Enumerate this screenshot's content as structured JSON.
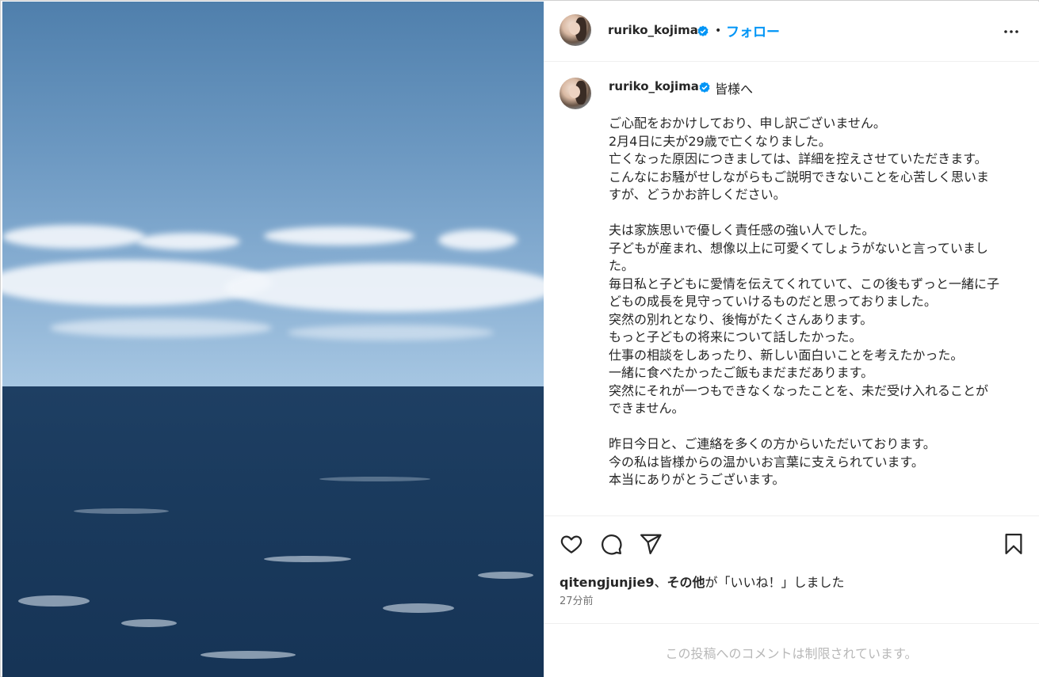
{
  "header": {
    "username": "ruriko_kojima",
    "separator": "•",
    "follow_label": "フォロー"
  },
  "caption": {
    "username": "ruriko_kojima",
    "lead": "皆様へ",
    "text": "ご心配をおかけしており、申し訳ございません。\n2月4日に夫が29歳で亡くなりました。\n亡くなった原因につきましては、詳細を控えさせていただきます。\nこんなにお騒がせしながらもご説明できないことを心苦しく思いますが、どうかお許しください。\n\n夫は家族思いで優しく責任感の強い人でした。\n子どもが産まれ、想像以上に可愛くてしょうがないと言っていました。\n毎日私と子どもに愛情を伝えてくれていて、この後もずっと一緒に子どもの成長を見守っていけるものだと思っておりました。\n突然の別れとなり、後悔がたくさんあります。\nもっと子どもの将来について話したかった。\n仕事の相談をしあったり、新しい面白いことを考えたかった。\n一緒に食べたかったご飯もまだまだあります。\n突然にそれが一つもできなくなったことを、未だ受け入れることができません。\n\n昨日今日と、ご連絡を多くの方からいただいております。\n今の私は皆様からの温かいお言葉に支えられています。\n本当にありがとうございます。"
  },
  "likes": {
    "user": "qitengjunjie9",
    "separator": "、",
    "others": "その他",
    "suffix": "が「いいね！」しました"
  },
  "timestamp": "27分前",
  "comments_notice": "この投稿へのコメントは制限されています。",
  "icons": {
    "like": "heart-icon",
    "comment": "comment-icon",
    "share": "share-icon",
    "save": "bookmark-icon",
    "more": "more-icon",
    "verified": "verified-badge-icon"
  },
  "colors": {
    "link": "#0095f6",
    "verified": "#0095f6",
    "muted": "#737373",
    "disabled": "#b8b8b8"
  }
}
